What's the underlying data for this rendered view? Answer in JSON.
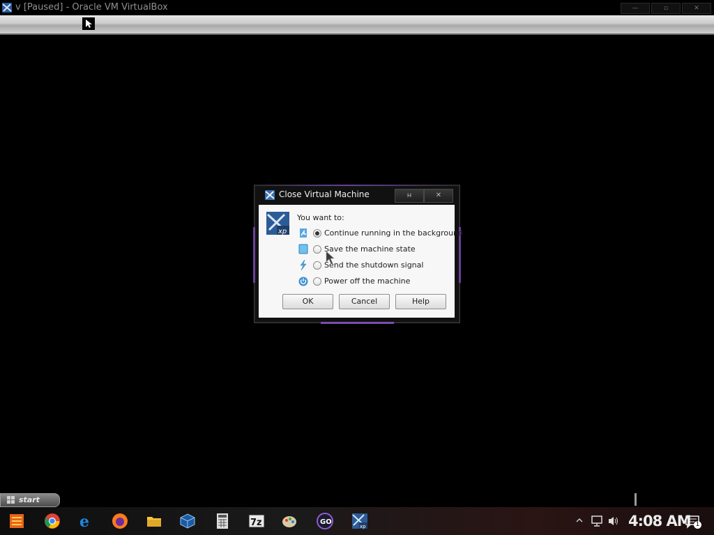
{
  "host_window": {
    "title": "v [Paused] - Oracle VM VirtualBox",
    "controls": [
      "—",
      "▫",
      "✕"
    ]
  },
  "dialog": {
    "title": "Close Virtual Machine",
    "title_buttons": [
      "н",
      "✕"
    ],
    "prompt": "You want to:",
    "options": [
      {
        "label": "Continue running in the background",
        "checked": true,
        "icon": "continue-icon"
      },
      {
        "label": "Save the machine state",
        "checked": false,
        "icon": "save-state-icon"
      },
      {
        "label": "Send the shutdown signal",
        "checked": false,
        "icon": "shutdown-signal-icon"
      },
      {
        "label": "Power off the machine",
        "checked": false,
        "icon": "power-icon"
      }
    ],
    "buttons": {
      "ok": "OK",
      "cancel": "Cancel",
      "help": "Help"
    }
  },
  "guest": {
    "start_label": "start"
  },
  "taskbar": {
    "apps": [
      "start-orb-icon",
      "chrome-icon",
      "edge-icon",
      "firefox-icon",
      "file-explorer-icon",
      "virtualbox-icon",
      "calculator-icon",
      "7zip-icon",
      "paint-icon",
      "go-icon",
      "xp-vm-icon"
    ],
    "tray_icons": [
      "chevron-up-icon",
      "network-icon",
      "volume-icon"
    ],
    "clock": "4:08 AM",
    "notification_count": "1"
  },
  "colors": {
    "accent_purple": "#7b4bb0",
    "dialog_frame": "#111111",
    "dialog_body": "#f7f7f7"
  }
}
